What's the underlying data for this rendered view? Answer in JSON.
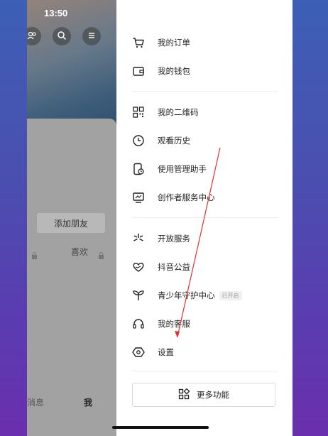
{
  "status_bar": {
    "time": "13:50"
  },
  "profile": {
    "add_friend_label": "添加朋友",
    "likes_label": "喜欢",
    "tabs": {
      "messages": "消息",
      "me": "我"
    }
  },
  "drawer": {
    "items": [
      {
        "label": "我的订单",
        "icon": "cart-icon"
      },
      {
        "label": "我的钱包",
        "icon": "wallet-icon"
      },
      {
        "label": "我的二维码",
        "icon": "qrcode-icon"
      },
      {
        "label": "观看历史",
        "icon": "clock-icon"
      },
      {
        "label": "使用管理助手",
        "icon": "phone-timer-icon"
      },
      {
        "label": "创作者服务中心",
        "icon": "chart-screen-icon"
      },
      {
        "label": "开放服务",
        "icon": "asterisk-icon"
      },
      {
        "label": "抖音公益",
        "icon": "charity-icon"
      },
      {
        "label": "青少年守护中心",
        "icon": "sprout-icon",
        "badge": "已开启"
      },
      {
        "label": "我的客服",
        "icon": "headset-icon"
      },
      {
        "label": "设置",
        "icon": "settings-icon"
      }
    ],
    "more_button": "更多功能"
  },
  "annotation_color": "#e03030"
}
